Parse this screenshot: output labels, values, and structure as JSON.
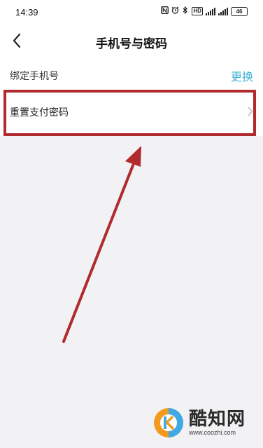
{
  "status_bar": {
    "time": "14:39",
    "icons": [
      "nfc-icon",
      "alarm-icon",
      "bluetooth-icon",
      "hd-icon",
      "signal-icon",
      "signal-icon"
    ],
    "hd_label": "HD",
    "battery": "46"
  },
  "nav": {
    "title": "手机号与密码",
    "back_icon": "chevron-left-icon"
  },
  "rows": {
    "phone": {
      "label": "绑定手机号",
      "action": "更换"
    },
    "reset_pay_password": {
      "label": "重置支付密码",
      "chevron": "chevron-right-icon"
    }
  },
  "annotation": {
    "highlight_color": "#b02a2e",
    "arrow_color": "#b02a2e"
  },
  "watermark": {
    "brand": "酷知网",
    "url": "www.coozhi.com",
    "logo_colors": [
      "#f39a1e",
      "#3fa9e6"
    ]
  },
  "colors": {
    "action": "#3fb0d6",
    "background": "#f2f2f4",
    "surface": "#ffffff"
  }
}
